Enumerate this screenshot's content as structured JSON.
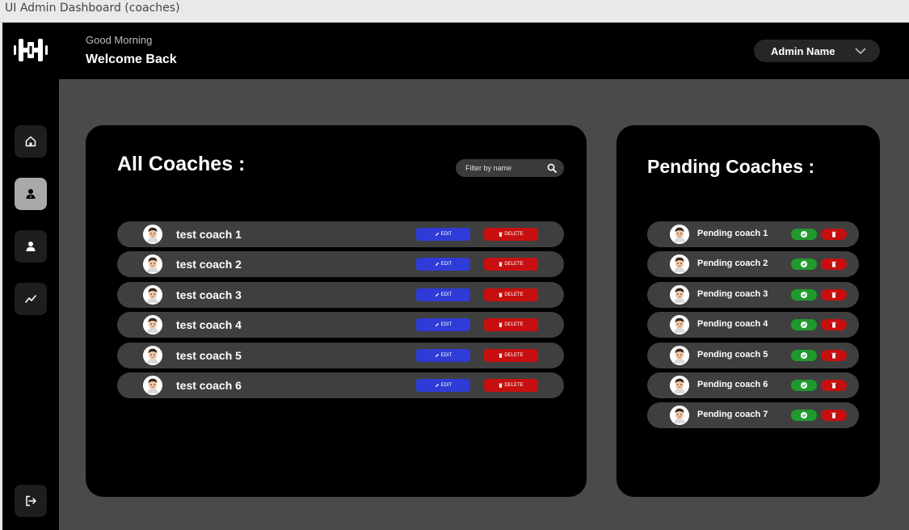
{
  "window": {
    "title": "UI Admin Dashboard (coaches)"
  },
  "header": {
    "greeting": "Good Morning",
    "welcome": "Welcome Back",
    "admin_name": "Admin Name"
  },
  "sidebar": {
    "items": [
      {
        "icon": "home-icon"
      },
      {
        "icon": "coach-icon"
      },
      {
        "icon": "user-icon"
      },
      {
        "icon": "chart-line-icon"
      }
    ],
    "logout_icon": "logout-icon"
  },
  "all_coaches": {
    "title": "All Coaches :",
    "filter_placeholder": "Filter by name",
    "edit_label": "EDIT",
    "delete_label": "DELETE",
    "coaches": [
      "test coach 1",
      "test coach 2",
      "test coach 3",
      "test coach 4",
      "test coach 5",
      "test coach 6"
    ]
  },
  "pending_coaches": {
    "title": "Pending Coaches :",
    "coaches": [
      "Pending coach 1",
      "Pending coach 2",
      "Pending coach 3",
      "Pending coach 4",
      "Pending coach 5",
      "Pending coach 6",
      "Pending coach 7"
    ]
  },
  "colors": {
    "edit": "#2f3bd6",
    "delete": "#c80f0f",
    "approve": "#1f9b2e"
  }
}
